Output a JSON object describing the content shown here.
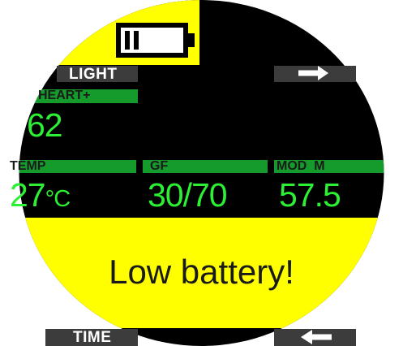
{
  "screen": {
    "colors": {
      "background": "#000000",
      "warning_yellow": "#ffff00",
      "header_green": "#159a2c",
      "value_green": "#2cf033",
      "button_gray": "#3c3c3c"
    }
  },
  "buttons": {
    "light_label": "LIGHT",
    "time_label": "TIME",
    "next_icon": "arrow-right-icon",
    "back_icon": "arrow-left-icon"
  },
  "battery": {
    "icon": "battery-icon",
    "level": 0.4
  },
  "heart": {
    "label": "HEART+",
    "value": "62"
  },
  "fields": {
    "temp": {
      "label": "TEMP",
      "value": "27",
      "unit": "°C"
    },
    "gf": {
      "label": "GF",
      "value": "30/70"
    },
    "mod": {
      "label": "MOD  M",
      "value": "57.5"
    }
  },
  "warning": {
    "message": "Low battery!"
  }
}
